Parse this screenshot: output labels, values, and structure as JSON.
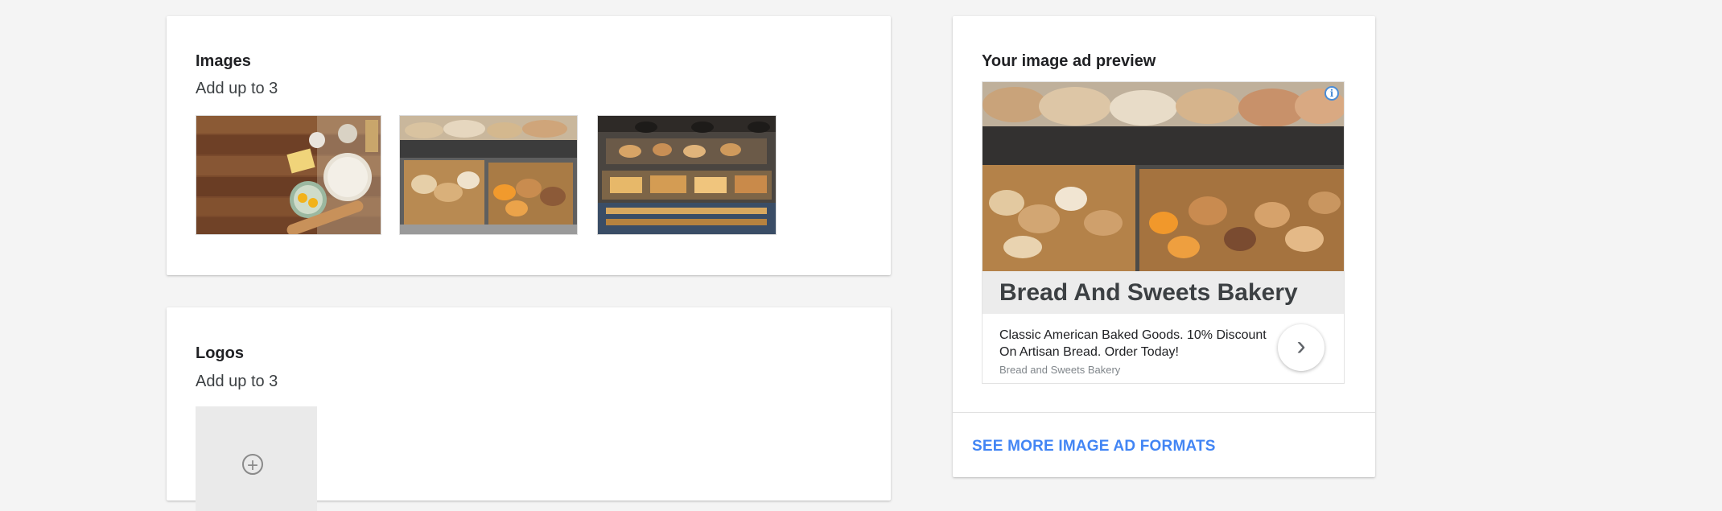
{
  "images_card": {
    "title": "Images",
    "subtitle": "Add up to 3",
    "thumbnails": [
      {
        "name": "baking-ingredients-image"
      },
      {
        "name": "bread-baskets-image"
      },
      {
        "name": "bakery-shop-image"
      }
    ]
  },
  "logos_card": {
    "title": "Logos",
    "subtitle": "Add up to 3",
    "add_icon": "plus-circle-icon",
    "add_glyph": "+"
  },
  "preview_card": {
    "title": "Your image ad preview",
    "ad": {
      "info_icon": "info-icon",
      "info_glyph": "i",
      "headline": "Bread And Sweets Bakery",
      "description": "Classic American Baked Goods. 10% Discount On Artisan Bread. Order Today!",
      "business_name": "Bread and Sweets Bakery",
      "arrow_icon": "chevron-right-icon",
      "arrow_glyph": "›"
    },
    "link_label": "SEE MORE IMAGE AD FORMATS"
  },
  "colors": {
    "background": "#f4f4f4",
    "card": "#ffffff",
    "link": "#4285f4",
    "headline_bar": "#ececec"
  }
}
